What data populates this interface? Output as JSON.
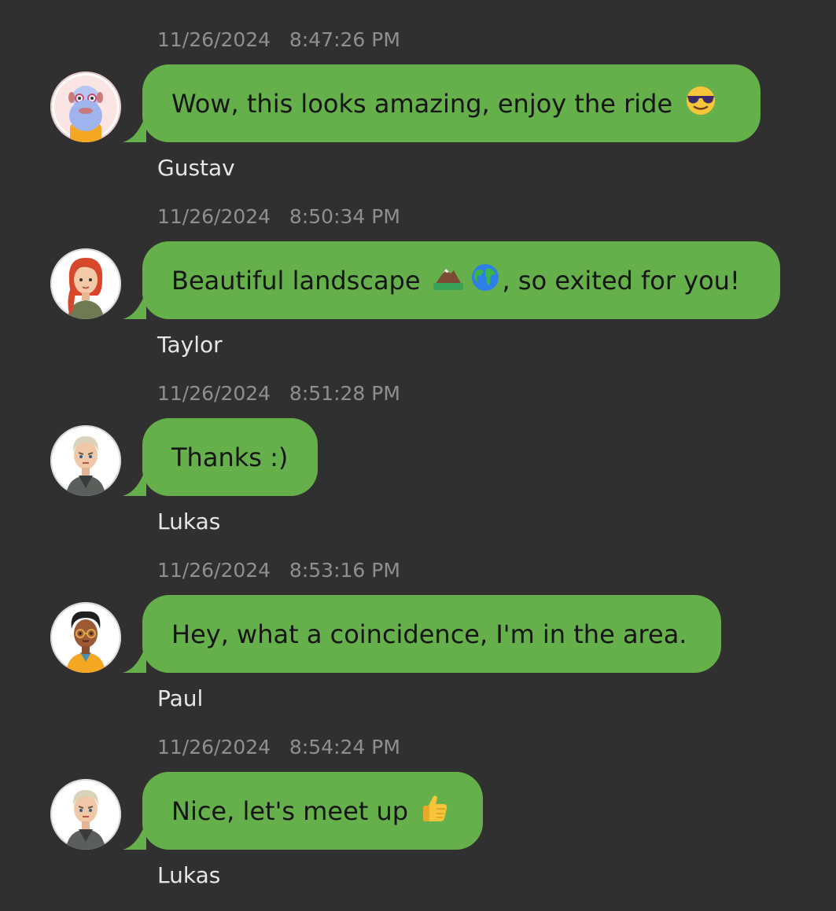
{
  "messages": [
    {
      "timestamp": "11/26/2024   8:47:26 PM",
      "text": "Wow, this looks amazing, enjoy the ride",
      "emoji_after": [
        "smiling-face-with-sunglasses-icon"
      ],
      "sender": "Gustav",
      "avatar": "gustav-avatar"
    },
    {
      "timestamp": "11/26/2024   8:50:34 PM",
      "text_before": "Beautiful landscape",
      "text_after": ", so exited for you!",
      "emoji_mid": [
        "mountain-icon",
        "globe-icon"
      ],
      "sender": "Taylor",
      "avatar": "taylor-avatar"
    },
    {
      "timestamp": "11/26/2024   8:51:28 PM",
      "text": "Thanks :)",
      "sender": "Lukas",
      "avatar": "lukas-avatar"
    },
    {
      "timestamp": "11/26/2024   8:53:16 PM",
      "text": "Hey, what a coincidence, I'm in the area.",
      "sender": "Paul",
      "avatar": "paul-avatar"
    },
    {
      "timestamp": "11/26/2024   8:54:24 PM",
      "text": "Nice, let's meet up",
      "emoji_after": [
        "thumbs-up-icon"
      ],
      "sender": "Lukas",
      "avatar": "lukas-avatar"
    }
  ],
  "colors": {
    "background": "#303030",
    "bubble": "#66b04b",
    "bubble_text": "#151515",
    "timestamp": "#8f8f8f",
    "sender": "#e6e6e6"
  }
}
